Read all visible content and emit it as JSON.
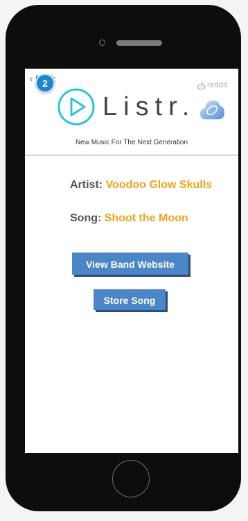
{
  "nav": {
    "back_label": "‹ Back",
    "badge_count": "2",
    "reddit_label": "reddit"
  },
  "header": {
    "brand": "Listr.",
    "tagline": "New Music For The Next Generation"
  },
  "song_info": {
    "artist_label": "Artist:",
    "artist_value": "Voodoo Glow Skulls",
    "song_label": "Song:",
    "song_value": "Shoot the Moon"
  },
  "actions": {
    "website_button": "View Band Website",
    "store_button": "Store Song"
  },
  "colors": {
    "accent_teal": "#2ec4d6",
    "value_orange": "#f0a21c",
    "button_blue": "#4d86c6"
  },
  "icons": {
    "play": "play-circle-icon",
    "cloud": "cloud-app-icon",
    "reddit": "reddit-alien-icon"
  }
}
